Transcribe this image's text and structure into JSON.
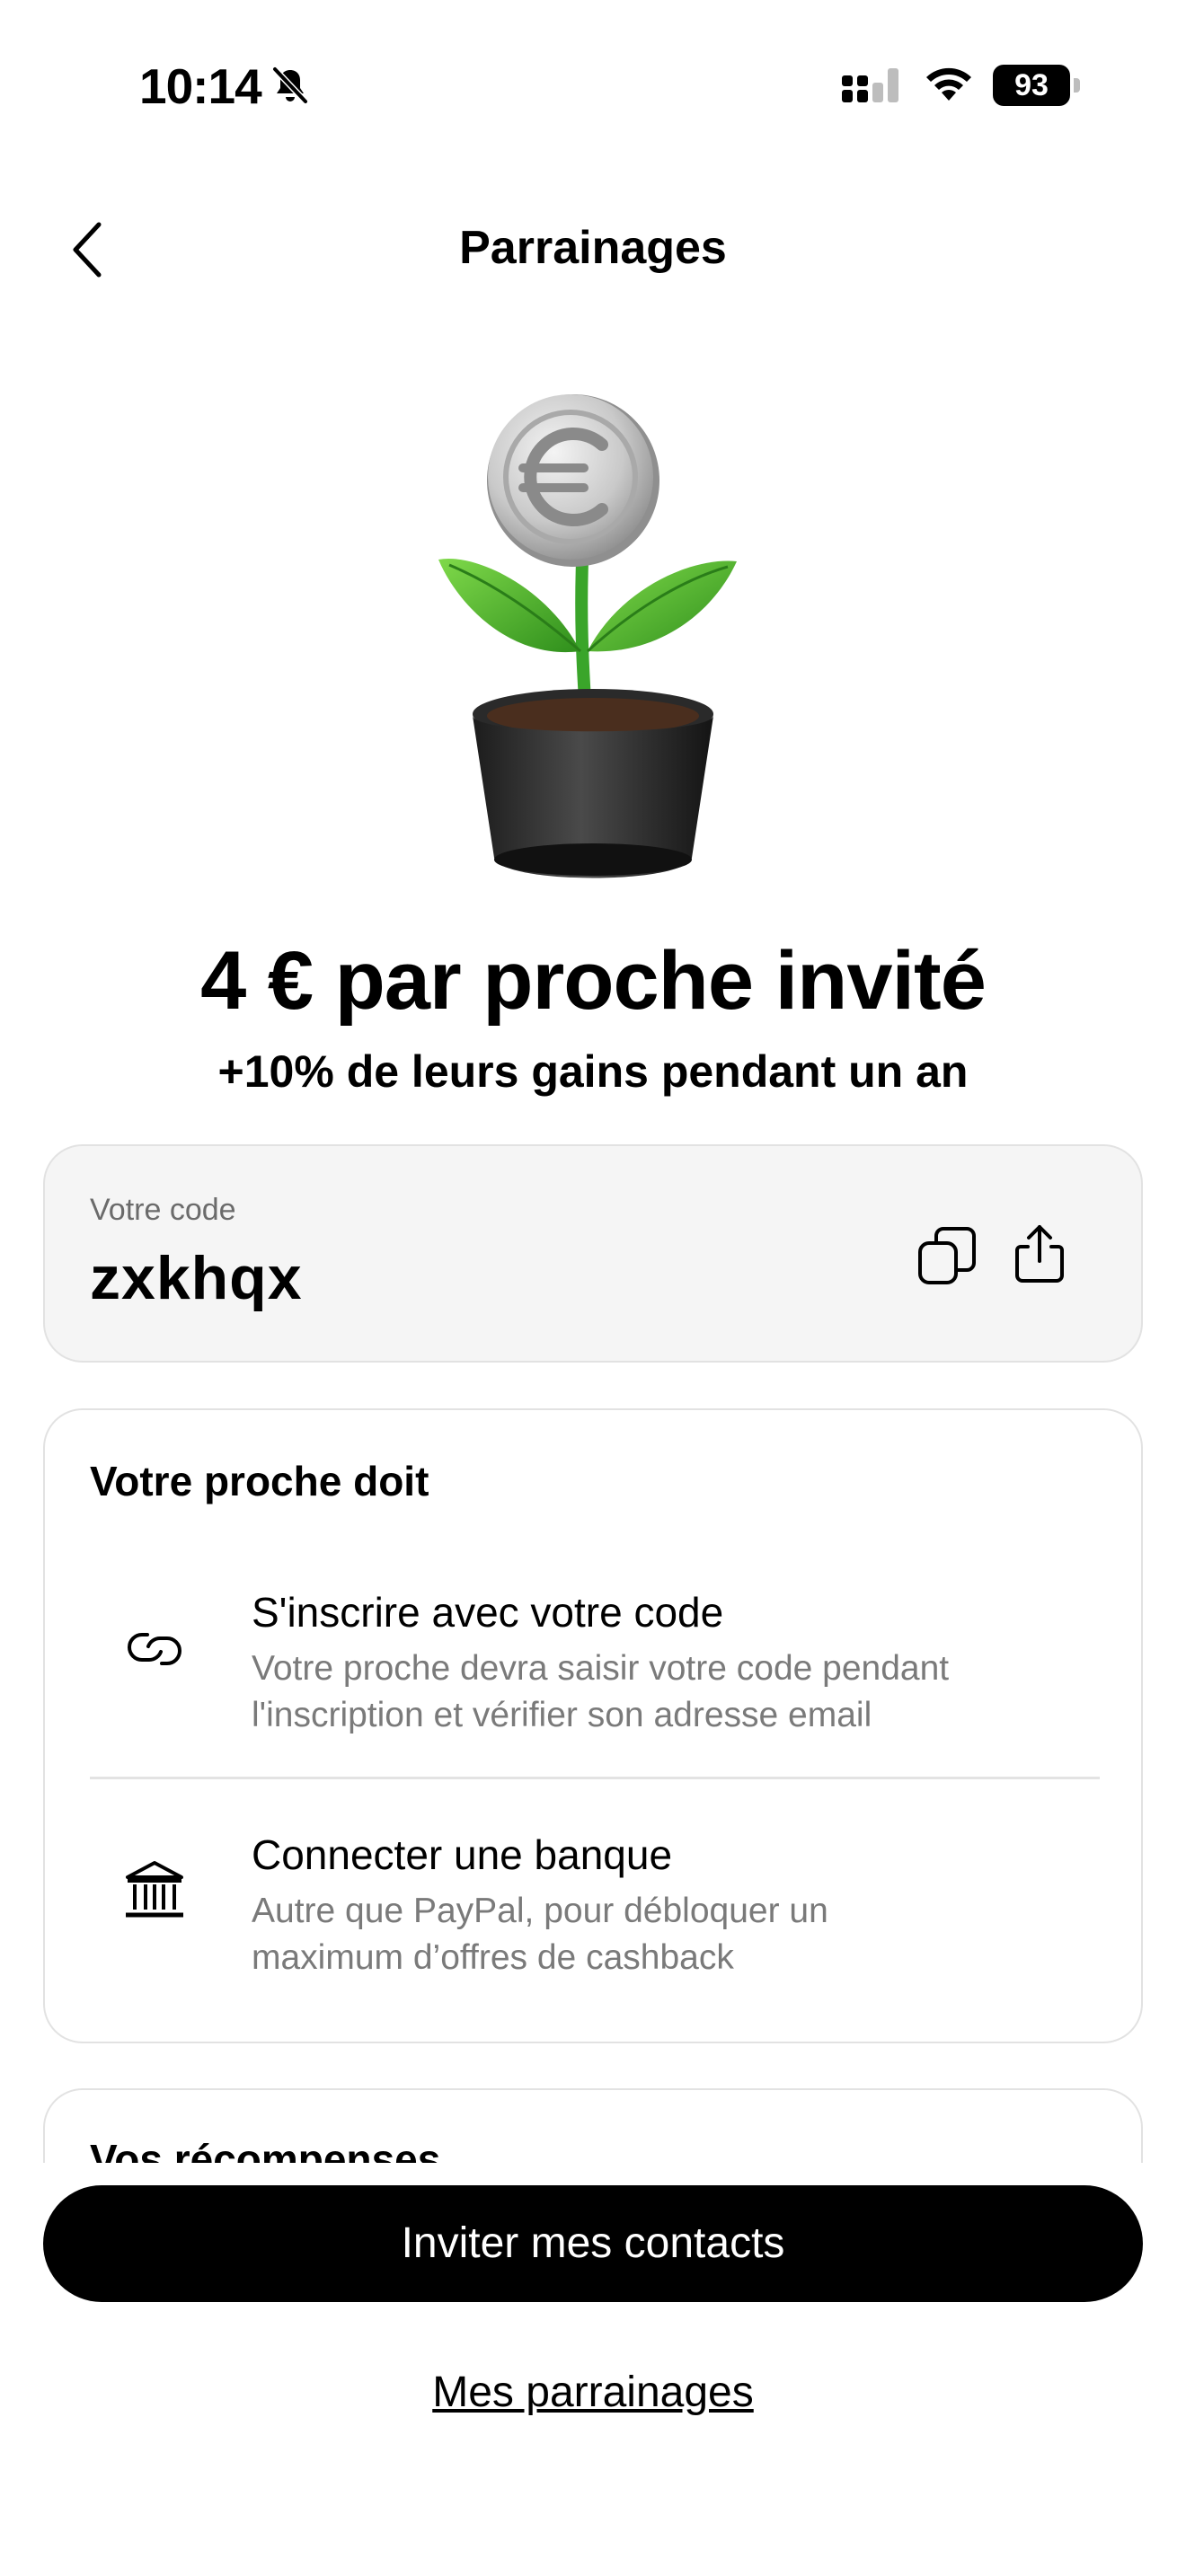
{
  "status_bar": {
    "time": "10:14",
    "battery_level": "93",
    "icons": [
      "bell-slash-icon",
      "cellular-signal-icon",
      "wifi-icon",
      "battery-icon"
    ]
  },
  "header": {
    "title": "Parrainages",
    "back_icon": "chevron-left-icon"
  },
  "hero": {
    "illustration": "plant-with-euro-coin",
    "headline": "4 € par proche invité",
    "subheadline": "+10% de leurs gains pendant un an"
  },
  "code_card": {
    "label": "Votre code",
    "code": "zxkhqx",
    "copy_icon": "copy-icon",
    "share_icon": "share-icon"
  },
  "steps_card": {
    "title": "Votre proche doit",
    "steps": [
      {
        "icon": "link-icon",
        "title": "S'inscrire avec votre code",
        "description_line1": "Votre proche devra saisir votre code pendant",
        "description_line2": "l'inscription et vérifier son adresse email"
      },
      {
        "icon": "bank-icon",
        "title": "Connecter une banque",
        "description_line1": "Autre que PayPal, pour débloquer un",
        "description_line2": "maximum d’offres de cashback"
      }
    ]
  },
  "rewards_card": {
    "title": "Vos récompenses"
  },
  "actions": {
    "invite_label": "Inviter mes contacts",
    "referrals_link": "Mes parrainages"
  }
}
